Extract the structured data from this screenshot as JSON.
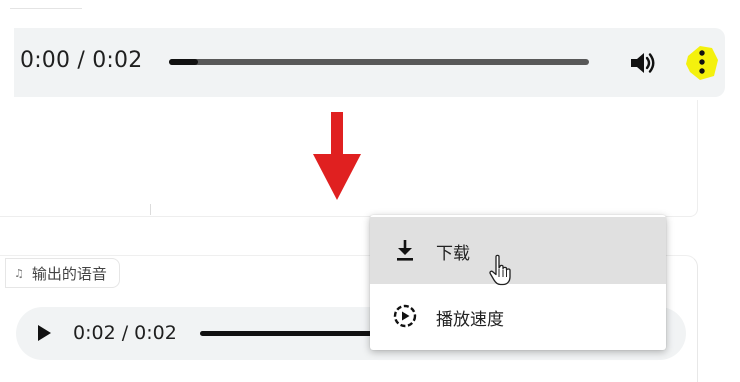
{
  "top_player": {
    "time": "0:00 / 0:02",
    "progress": 0.07,
    "volume_icon": "speaker-icon",
    "more_icon": "more-vert-icon",
    "highlight_color": "#f3f000"
  },
  "annotation": {
    "arrow_color": "#e02020",
    "arrow_icon": "down-arrow-icon"
  },
  "output_audio": {
    "tag_label": "输出的语音",
    "time": "0:02 / 0:02",
    "play_icon": "play-icon"
  },
  "context_menu": {
    "items": [
      {
        "label": "下载",
        "icon": "download-icon",
        "highlighted": true
      },
      {
        "label": "播放速度",
        "icon": "playback-speed-icon",
        "highlighted": false
      }
    ]
  },
  "colors": {
    "player_bg": "#f1f3f4",
    "menu_hover": "#e0e0e0"
  }
}
